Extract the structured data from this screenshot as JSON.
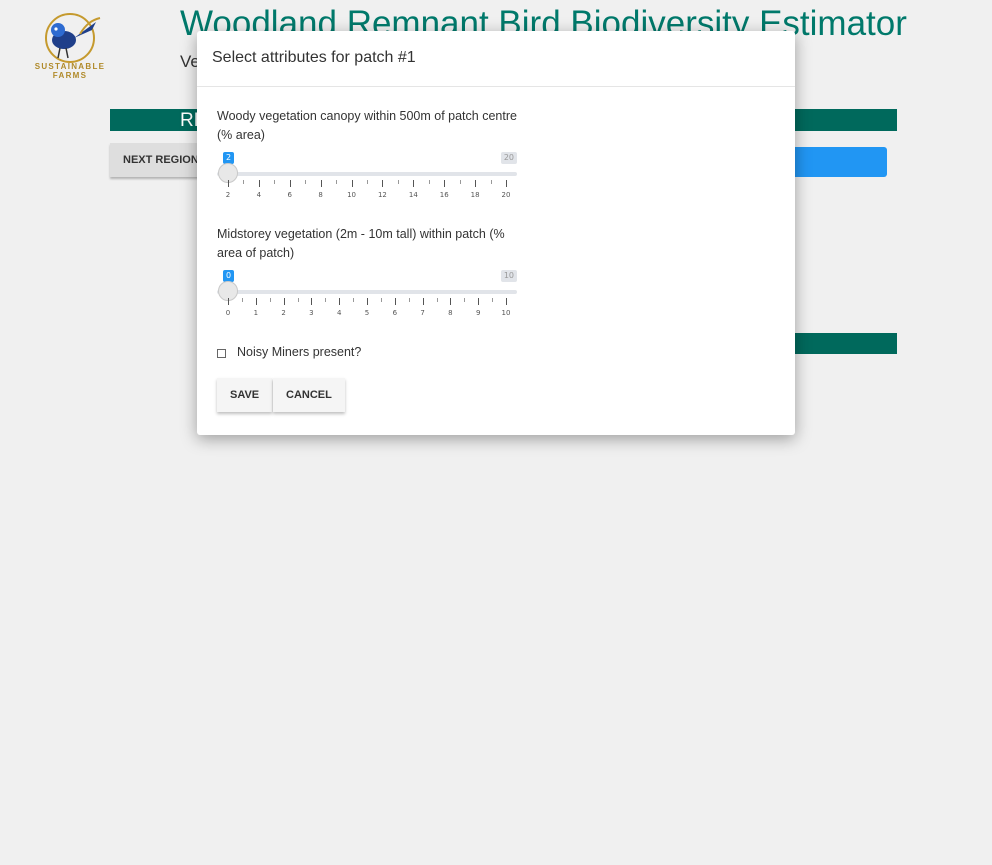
{
  "app": {
    "title": "Woodland Remnant Bird Biodiversity Estimator",
    "subtitle": "Ve",
    "logo_text": "SUSTAINABLE FARMS"
  },
  "background": {
    "section_heading": "RE",
    "next_region_label": "NEXT REGION"
  },
  "colors": {
    "primary_teal": "#00796b",
    "dark_teal": "#00695c",
    "accent_blue": "#2196f3"
  },
  "modal": {
    "title": "Select attributes for patch #1",
    "sliders": [
      {
        "label": "Woody vegetation canopy within 500m of patch centre (% area)",
        "min": 2,
        "max": 20,
        "value": 2,
        "value_label": "2",
        "max_label": "20",
        "tick_labels": [
          "2",
          "4",
          "6",
          "8",
          "10",
          "12",
          "14",
          "16",
          "18",
          "20"
        ],
        "minor_per_major": 1
      },
      {
        "label": "Midstorey vegetation (2m - 10m tall) within patch (% area of patch)",
        "min": 0,
        "max": 10,
        "value": 0,
        "value_label": "0",
        "max_label": "10",
        "tick_labels": [
          "0",
          "1",
          "2",
          "3",
          "4",
          "5",
          "6",
          "7",
          "8",
          "9",
          "10"
        ],
        "minor_per_major": 1
      }
    ],
    "checkbox": {
      "label": "Noisy Miners present?",
      "checked": false
    },
    "buttons": {
      "save": "Save",
      "cancel": "Cancel"
    }
  }
}
